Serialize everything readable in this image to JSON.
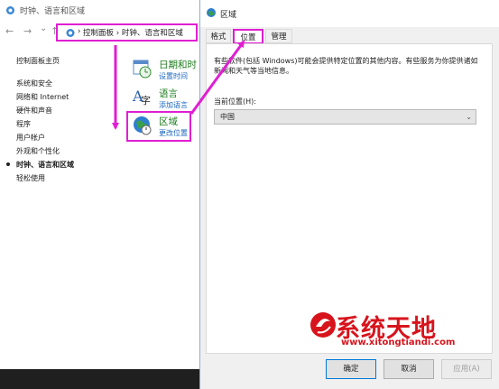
{
  "control_panel": {
    "title": "时钟、语言和区域",
    "breadcrumb": [
      "控制面板",
      "时钟、语言和区域"
    ],
    "breadcrumb_sep": "›",
    "nav": {
      "back": "←",
      "forward": "→",
      "down": "⌄",
      "up": "↑"
    },
    "sidebar": [
      "控制面板主页",
      "系统和安全",
      "网络和 Internet",
      "硬件和声音",
      "程序",
      "用户帐户",
      "外观和个性化",
      "时钟、语言和区域",
      "轻松使用"
    ],
    "active_sidebar_index": 7,
    "categories": [
      {
        "title": "日期和时",
        "link": "设置时间"
      },
      {
        "title": "语言",
        "link": "添加语言"
      },
      {
        "title": "区域",
        "link": "更改位置"
      }
    ]
  },
  "dialog": {
    "title": "区域",
    "tabs": [
      "格式",
      "位置",
      "管理"
    ],
    "active_tab": 1,
    "description": "有些软件(包括 Windows)可能会提供特定位置的其他内容。有些服务为你提供诸如新闻和天气等当地信息。",
    "location_label": "当前位置(H):",
    "location_value": "中国",
    "buttons": {
      "ok": "确定",
      "cancel": "取消",
      "apply": "应用(A)"
    }
  },
  "watermark": {
    "text": "系统天地",
    "url": "www.xitongtiandi.com"
  },
  "colors": {
    "highlight": "#e01fd2",
    "link": "#1a66c0",
    "category": "#1e7d1e",
    "watermark": "#d7141c"
  }
}
